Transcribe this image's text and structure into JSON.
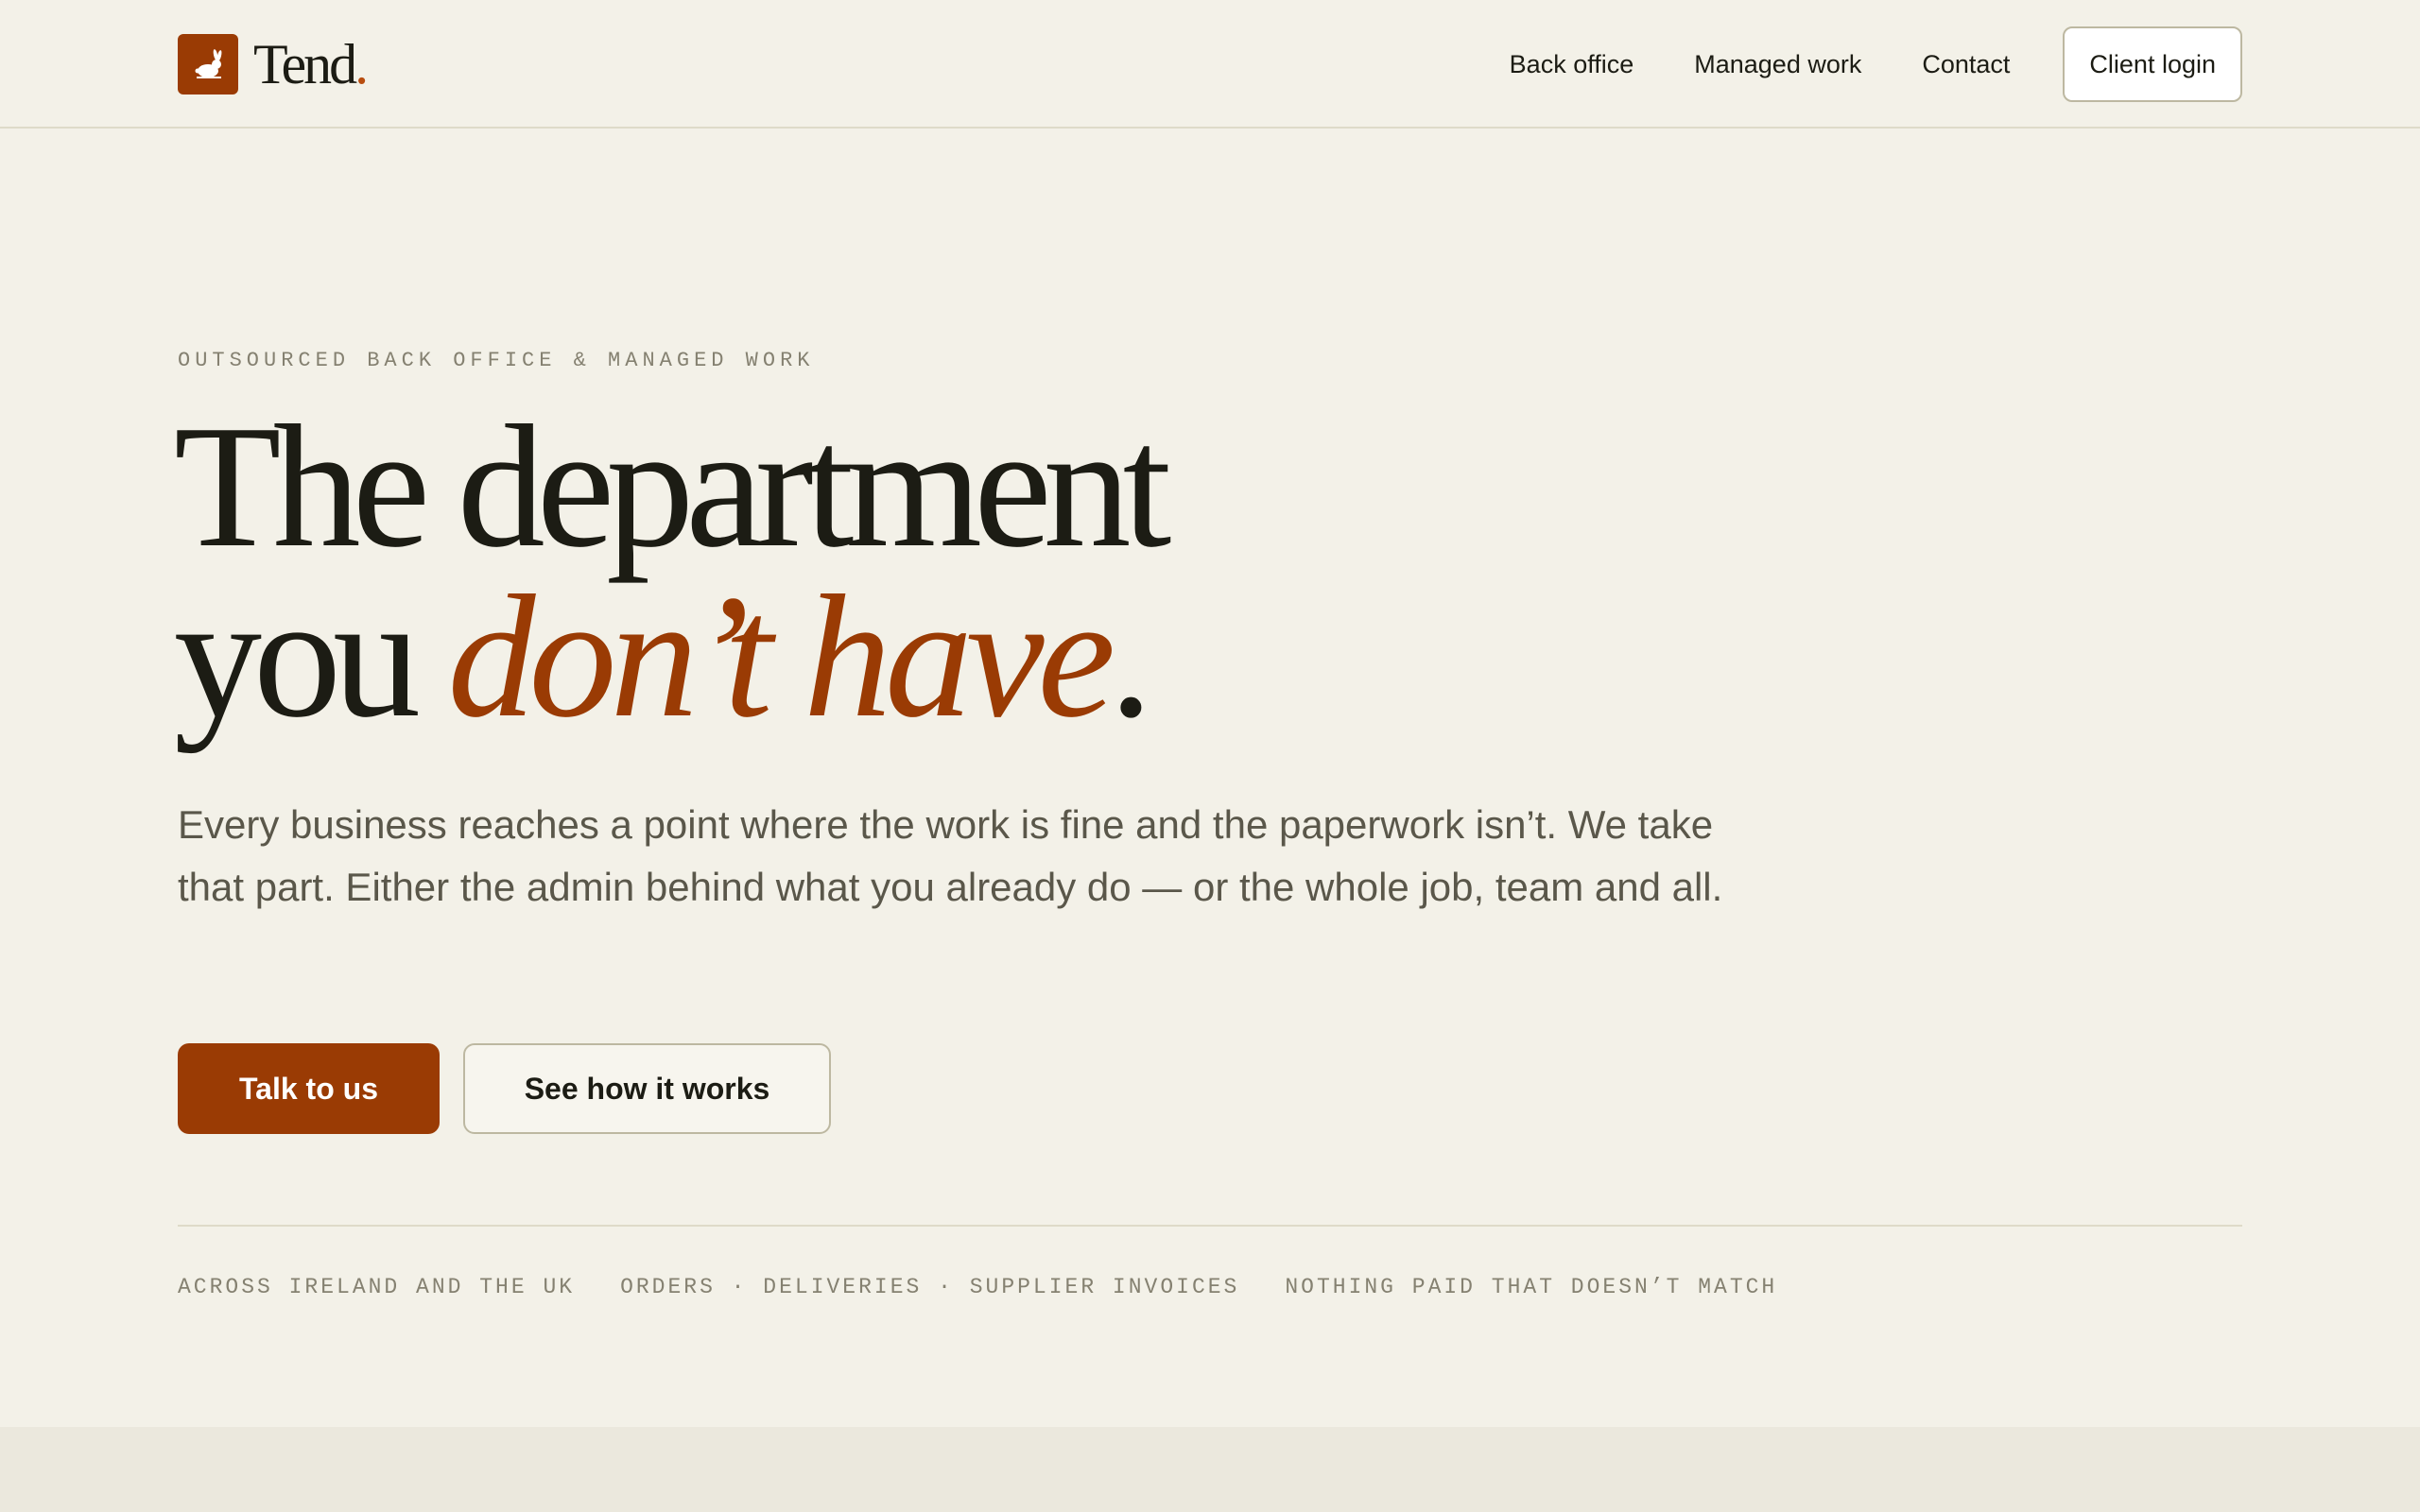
{
  "brand": {
    "name": "Tend",
    "dot": ".",
    "logo_icon": "rabbit-icon",
    "accent_color": "#9a3b04"
  },
  "nav": {
    "items": [
      {
        "label": "Back office"
      },
      {
        "label": "Managed work"
      },
      {
        "label": "Contact"
      }
    ],
    "login_label": "Client login"
  },
  "hero": {
    "eyebrow": "OUTSOURCED BACK OFFICE & MANAGED WORK",
    "headline_line1": "The department",
    "headline_line2_start": "you ",
    "headline_emphasis": "don’t have",
    "headline_end": ".",
    "lead": "Every business reaches a point where the work is fine and the paperwork isn’t. We take that part. Either the admin behind what you already do — or the whole job, team and all.",
    "primary_cta": "Talk to us",
    "secondary_cta": "See how it works"
  },
  "facts": [
    "ACROSS IRELAND AND THE UK",
    "ORDERS · DELIVERIES · SUPPLIER INVOICES",
    "NOTHING PAID THAT DOESN’T MATCH"
  ]
}
